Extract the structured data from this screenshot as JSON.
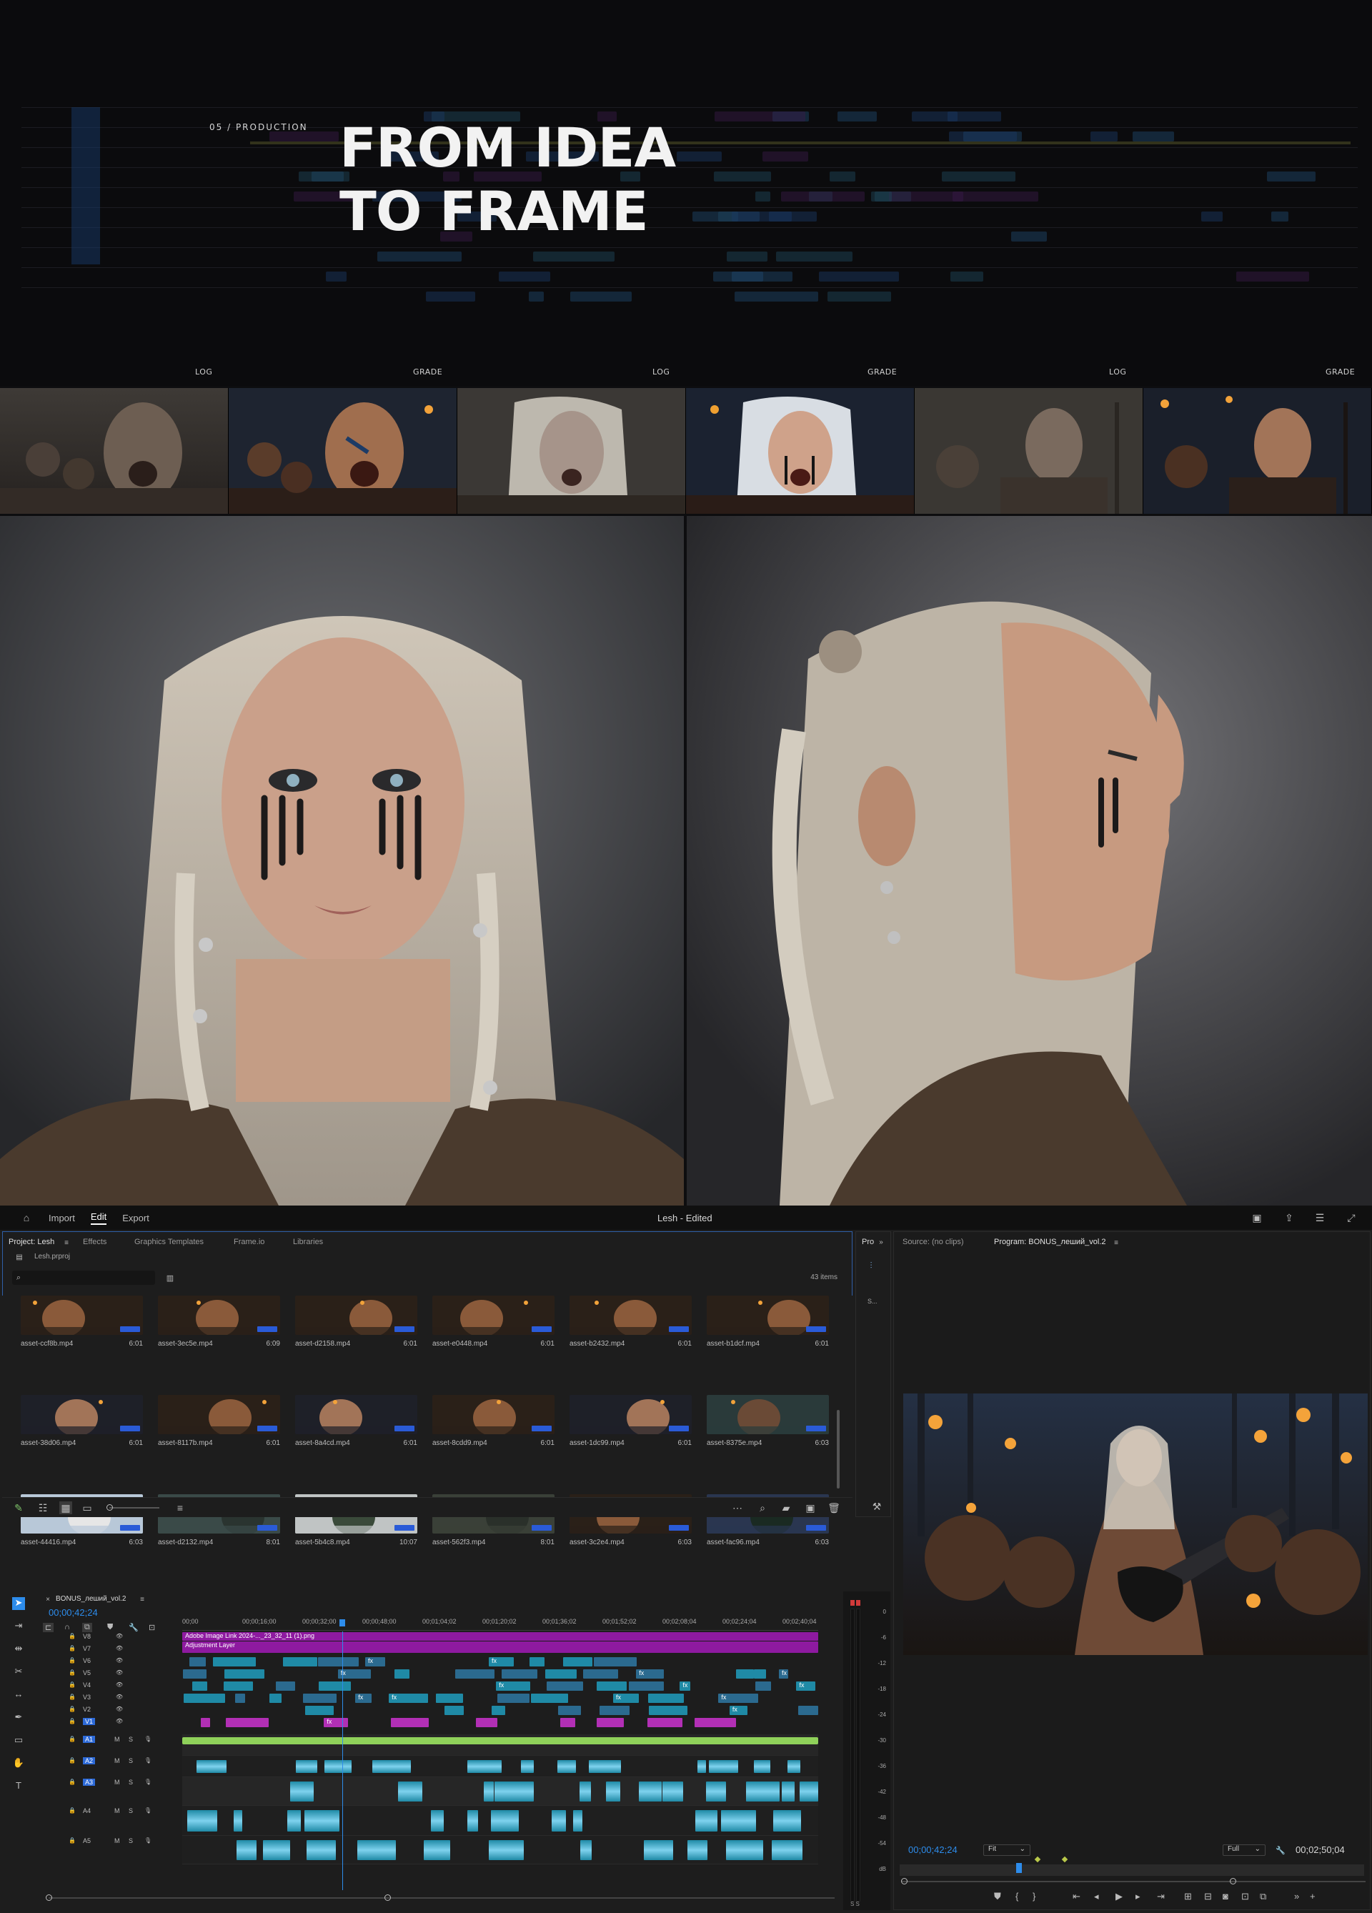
{
  "hero": {
    "section_label": "05 / PRODUCTION",
    "title_line1": "FROM IDEA",
    "title_line2": "TO FRAME",
    "captions": [
      "LOG",
      "GRADE",
      "LOG",
      "GRADE",
      "LOG",
      "GRADE"
    ]
  },
  "strip_frames": [
    {
      "name": "log-1",
      "tone": "log"
    },
    {
      "name": "grade-1",
      "tone": "grade"
    },
    {
      "name": "log-2",
      "tone": "log"
    },
    {
      "name": "grade-2",
      "tone": "grade"
    },
    {
      "name": "log-3",
      "tone": "log"
    },
    {
      "name": "grade-3",
      "tone": "grade"
    }
  ],
  "app": {
    "workspace_tabs": [
      "Import",
      "Edit",
      "Export"
    ],
    "active_tab": "Edit",
    "document_title": "Lesh - Edited",
    "project_panel": {
      "tabs": [
        "Project: Lesh",
        "Effects",
        "Graphics Templates",
        "Frame.io",
        "Libraries"
      ],
      "project_file": "Lesh.prproj",
      "item_count": "43 items",
      "search_placeholder": "",
      "assets": [
        {
          "name": "asset-ccf8b.mp4",
          "duration": "6:01",
          "scene": "crowd-warm"
        },
        {
          "name": "asset-3ec5e.mp4",
          "duration": "6:09",
          "scene": "crowd-warm"
        },
        {
          "name": "asset-d2158.mp4",
          "duration": "6:01",
          "scene": "crowd-warm"
        },
        {
          "name": "asset-e0448.mp4",
          "duration": "6:01",
          "scene": "crowd-warm"
        },
        {
          "name": "asset-b2432.mp4",
          "duration": "6:01",
          "scene": "crowd-warm"
        },
        {
          "name": "asset-b1dcf.mp4",
          "duration": "6:01",
          "scene": "crowd-warm"
        },
        {
          "name": "asset-38d06.mp4",
          "duration": "6:01",
          "scene": "warrior"
        },
        {
          "name": "asset-8117b.mp4",
          "duration": "6:01",
          "scene": "crowd-warm"
        },
        {
          "name": "asset-8a4cd.mp4",
          "duration": "6:01",
          "scene": "warrior"
        },
        {
          "name": "asset-8cdd9.mp4",
          "duration": "6:01",
          "scene": "crowd-warm"
        },
        {
          "name": "asset-1dc99.mp4",
          "duration": "6:01",
          "scene": "warrior"
        },
        {
          "name": "asset-8375e.mp4",
          "duration": "6:03",
          "scene": "forest-crowd"
        },
        {
          "name": "asset-44416.mp4",
          "duration": "6:03",
          "scene": "horses-beach"
        },
        {
          "name": "asset-d2132.mp4",
          "duration": "8:01",
          "scene": "forest"
        },
        {
          "name": "asset-5b4c8.mp4",
          "duration": "10:07",
          "scene": "foggy-forest"
        },
        {
          "name": "asset-562f3.mp4",
          "duration": "8:01",
          "scene": "forest-figure"
        },
        {
          "name": "asset-3c2e4.mp4",
          "duration": "6:03",
          "scene": "crowd-warm"
        },
        {
          "name": "asset-fac96.mp4",
          "duration": "6:03",
          "scene": "dusk-landscape"
        }
      ]
    },
    "side_panel_tabs": [
      "Pro",
      "S..."
    ],
    "source_monitor": {
      "label": "Source: (no clips)"
    },
    "program_monitor": {
      "label": "Program: BONUS_леший_vol.2",
      "timecode_current": "00;00;42;24",
      "fit": "Fit",
      "quality": "Full",
      "timecode_total": "00;02;50;04",
      "playhead_fraction": 0.25
    },
    "timeline": {
      "sequence_name": "BONUS_леший_vol.2",
      "timecode": "00;00;42;24",
      "ruler_ticks": [
        "00;00",
        "00;00;16;00",
        "00;00;32;00",
        "00;00;48;00",
        "00;01;04;02",
        "00;01;20;02",
        "00;01;36;02",
        "00;01;52;02",
        "00;02;08;04",
        "00;02;24;04",
        "00;02;40;04"
      ],
      "video_tracks": [
        "V8",
        "V7",
        "V6",
        "V5",
        "V4",
        "V3",
        "V2",
        "V1"
      ],
      "audio_tracks": [
        "A1",
        "A2",
        "A3",
        "A4",
        "A5"
      ],
      "track_buttons": {
        "mute": "M",
        "solo": "S"
      },
      "adjustment_layer_label": "Adjustment Layer",
      "top_clip_label": "Adobe Image Link 2024-..._23_32_11 (1).png",
      "fx_label": "fx"
    },
    "audio_meter_scale": [
      "0",
      "-6",
      "-12",
      "-18",
      "-24",
      "-30",
      "-36",
      "-42",
      "-48",
      "-54",
      "dB"
    ],
    "meter_footer": "S S"
  },
  "colors": {
    "accent_blue": "#2d8ceb",
    "clip_blue": "#2b6a8f",
    "clip_teal": "#1f8aa6",
    "clip_purple": "#b22fb5",
    "adjustment_purple": "#8e1aa0",
    "audio_green": "#8fd15a",
    "record_red": "#d23a3a"
  }
}
